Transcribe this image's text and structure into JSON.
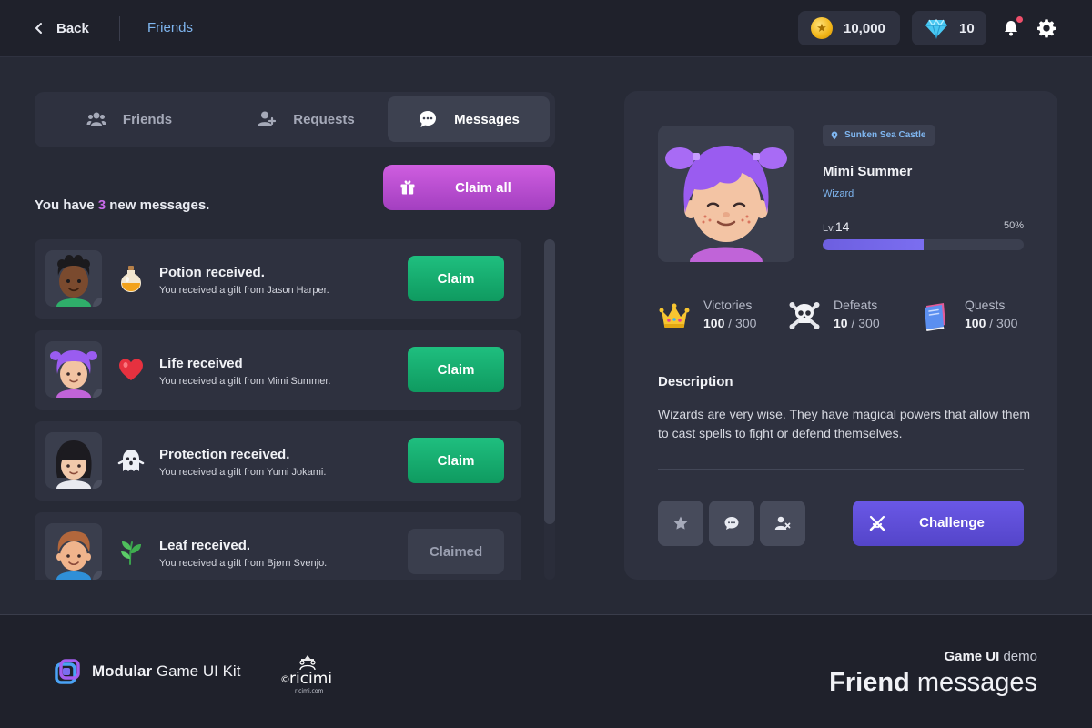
{
  "topbar": {
    "back_label": "Back",
    "breadcrumb": "Friends",
    "coins": "10,000",
    "gems": "10",
    "notification_dot_color": "#ef4f6b"
  },
  "tabs": [
    {
      "label": "Friends",
      "icon": "friends-icon",
      "active": false
    },
    {
      "label": "Requests",
      "icon": "add-user-icon",
      "active": false
    },
    {
      "label": "Messages",
      "icon": "chat-bubble-icon",
      "active": true
    }
  ],
  "claim_all_label": "Claim all",
  "new_messages": {
    "prefix": "You have",
    "count": "3",
    "suffix": "new messages."
  },
  "messages": [
    {
      "title": "Potion received.",
      "subtitle": "You received a gift from Jason Harper.",
      "gift_icon": "potion-icon",
      "button": "Claim",
      "claimed": false
    },
    {
      "title": "Life received",
      "subtitle": "You received a gift from Mimi Summer.",
      "gift_icon": "heart-icon",
      "button": "Claim",
      "claimed": false
    },
    {
      "title": "Protection received.",
      "subtitle": "You received a gift from Yumi Jokami.",
      "gift_icon": "ghost-icon",
      "button": "Claim",
      "claimed": false
    },
    {
      "title": "Leaf received.",
      "subtitle": "You received a gift from Bjørn Svenjo.",
      "gift_icon": "leaf-icon",
      "button": "Claimed",
      "claimed": true
    }
  ],
  "profile": {
    "location": "Sunken Sea Castle",
    "name": "Mimi Summer",
    "class": "Wizard",
    "level_prefix": "Lv.",
    "level": "14",
    "progress_label": "50%",
    "progress": 0.5,
    "stats": [
      {
        "label": "Victories",
        "value": "100",
        "total": "/ 300",
        "icon": "crown-icon"
      },
      {
        "label": "Defeats",
        "value": "10",
        "total": "/ 300",
        "icon": "skull-icon"
      },
      {
        "label": "Quests",
        "value": "100",
        "total": "/ 300",
        "icon": "book-icon"
      }
    ],
    "description_heading": "Description",
    "description": "Wizards are very wise. They have magical powers that allow them to cast spells to fight or defend themselves.",
    "challenge_label": "Challenge"
  },
  "footer": {
    "brand_bold": "Modular",
    "brand_rest": "Game UI Kit",
    "demo_sub_bold": "Game UI",
    "demo_sub_rest": "demo",
    "demo_title_bold": "Friend",
    "demo_title_rest": "messages",
    "copyright": "©",
    "logo_text": "ricimi",
    "logo_url_text": "ricimi.com"
  },
  "colors": {
    "accent_blue": "#7fb6f0",
    "claim_green": "#1fbf7f",
    "claim_all_purple": "#cf5ee0",
    "challenge_indigo": "#6a58e6",
    "count_highlight": "#c76ae8"
  }
}
